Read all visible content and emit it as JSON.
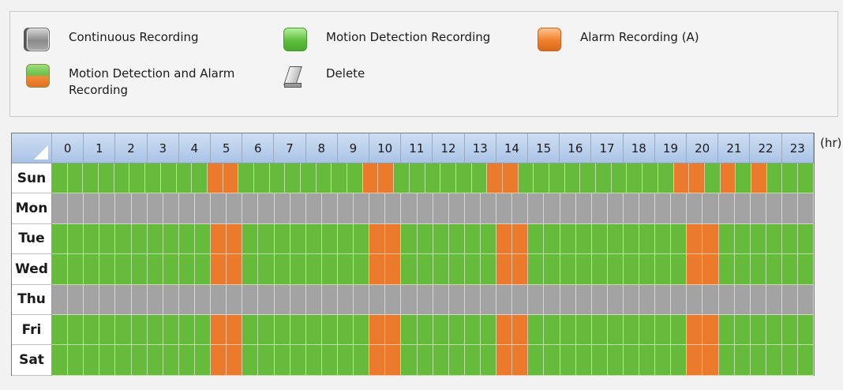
{
  "legend": {
    "continuous": "Continuous Recording",
    "motion": "Motion Detection Recording",
    "alarm": "Alarm Recording (A)",
    "motion_alarm": "Motion Detection and Alarm Recording",
    "delete": "Delete"
  },
  "schedule": {
    "unit_label": "(hr)",
    "hours": [
      "0",
      "1",
      "2",
      "3",
      "4",
      "5",
      "6",
      "7",
      "8",
      "9",
      "10",
      "11",
      "12",
      "13",
      "14",
      "15",
      "16",
      "17",
      "18",
      "19",
      "20",
      "21",
      "22",
      "23"
    ],
    "slots_per_hour": 2,
    "types": {
      "c": "Continuous Recording",
      "m": "Motion Detection Recording",
      "a": "Alarm Recording (A)"
    },
    "colors": {
      "continuous": "#a3a3a3",
      "motion": "#66bb3a",
      "alarm": "#eb7a2c"
    },
    "days": [
      {
        "name": "Sun",
        "slots": "mmmmmmmmmmaammmmmmmmaammmmmmaammmmmmmmmmaamamammm"
      },
      {
        "name": "Mon",
        "slots": "cccccccccccccccccccccccccccccccccccccccccccccccc"
      },
      {
        "name": "Tue",
        "slots": "mmmmmmmmmmaammmmmmmmaammmmmmaammmmmmmmmmaammmmmm"
      },
      {
        "name": "Wed",
        "slots": "mmmmmmmmmmaammmmmmmmaammmmmmaammmmmmmmmmaammmmmm"
      },
      {
        "name": "Thu",
        "slots": "cccccccccccccccccccccccccccccccccccccccccccccccc"
      },
      {
        "name": "Fri",
        "slots": "mmmmmmmmmmaammmmmmmmaammmmmmaammmmmmmmmmaammmmmm"
      },
      {
        "name": "Sat",
        "slots": "mmmmmmmmmmaammmmmmmmaammmmmmaammmmmmmmmmaammmmmm"
      }
    ]
  }
}
